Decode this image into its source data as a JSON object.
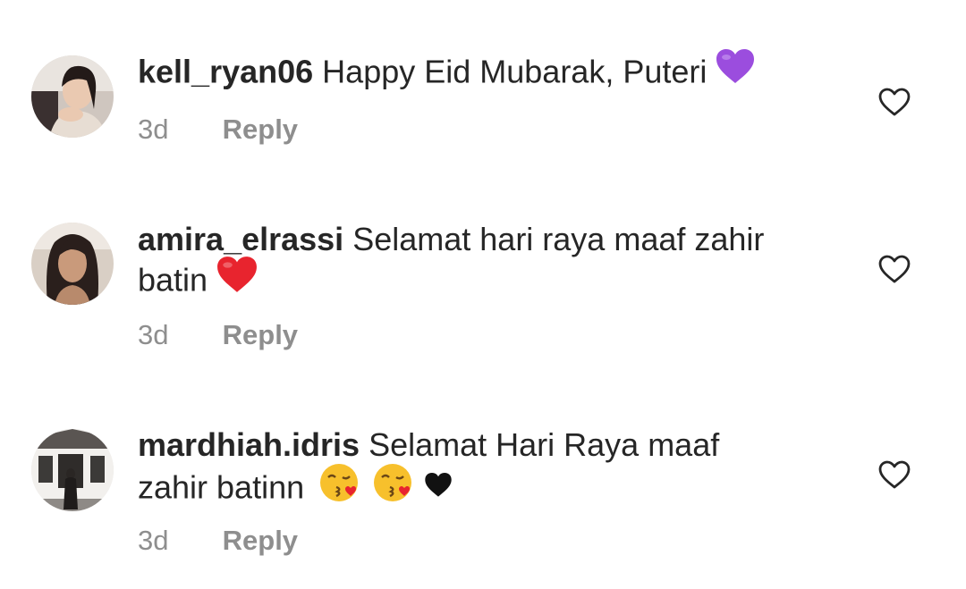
{
  "comments": [
    {
      "username": "kell_ryan06",
      "text": "Happy Eid Mubarak, Puteri",
      "text_line2": "",
      "emojis": [
        "purple-heart"
      ],
      "time": "3d",
      "reply_label": "Reply"
    },
    {
      "username": "amira_elrassi",
      "text": "Selamat hari raya maaf zahir",
      "text_line2": "batin",
      "emojis": [
        "red-heart"
      ],
      "time": "3d",
      "reply_label": "Reply"
    },
    {
      "username": "mardhiah.idris",
      "text": "Selamat Hari Raya maaf",
      "text_line2": "zahir batinn",
      "emojis": [
        "kissing-face",
        "kissing-face",
        "black-heart"
      ],
      "time": "3d",
      "reply_label": "Reply"
    }
  ],
  "icons": {
    "like": "heart-outline-icon"
  },
  "colors": {
    "text": "#262626",
    "meta": "#8e8e8e",
    "purple_heart": "#9b4dde",
    "red_heart": "#e8242e",
    "black_heart": "#111111"
  }
}
